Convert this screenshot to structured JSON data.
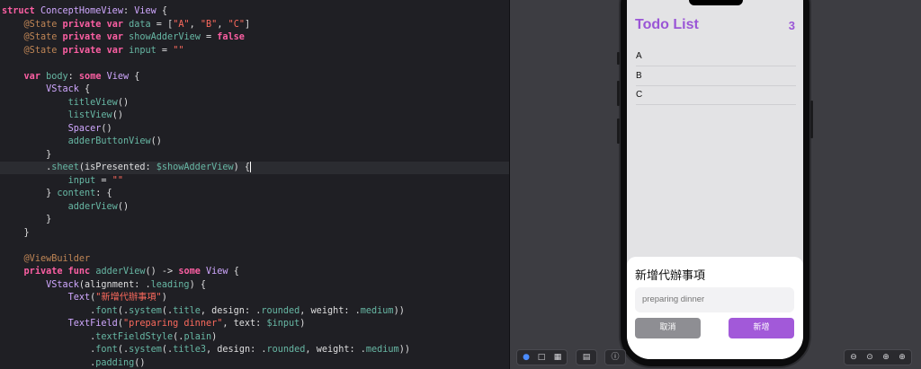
{
  "code": {
    "lines": [
      [
        {
          "t": "struct",
          "c": "kw"
        },
        {
          "t": " ",
          "c": "pl"
        },
        {
          "t": "ConceptHomeView",
          "c": "ty"
        },
        {
          "t": ": ",
          "c": "pl"
        },
        {
          "t": "View",
          "c": "ty"
        },
        {
          "t": " {",
          "c": "pl"
        }
      ],
      [
        {
          "t": "    ",
          "c": "pl"
        },
        {
          "t": "@State",
          "c": "attr"
        },
        {
          "t": " ",
          "c": "pl"
        },
        {
          "t": "private",
          "c": "kw"
        },
        {
          "t": " ",
          "c": "pl"
        },
        {
          "t": "var",
          "c": "kw"
        },
        {
          "t": " ",
          "c": "pl"
        },
        {
          "t": "data",
          "c": "prop"
        },
        {
          "t": " = [",
          "c": "pl"
        },
        {
          "t": "\"A\"",
          "c": "str"
        },
        {
          "t": ", ",
          "c": "pl"
        },
        {
          "t": "\"B\"",
          "c": "str"
        },
        {
          "t": ", ",
          "c": "pl"
        },
        {
          "t": "\"C\"",
          "c": "str"
        },
        {
          "t": "]",
          "c": "pl"
        }
      ],
      [
        {
          "t": "    ",
          "c": "pl"
        },
        {
          "t": "@State",
          "c": "attr"
        },
        {
          "t": " ",
          "c": "pl"
        },
        {
          "t": "private",
          "c": "kw"
        },
        {
          "t": " ",
          "c": "pl"
        },
        {
          "t": "var",
          "c": "kw"
        },
        {
          "t": " ",
          "c": "pl"
        },
        {
          "t": "showAdderView",
          "c": "prop"
        },
        {
          "t": " = ",
          "c": "pl"
        },
        {
          "t": "false",
          "c": "kw"
        }
      ],
      [
        {
          "t": "    ",
          "c": "pl"
        },
        {
          "t": "@State",
          "c": "attr"
        },
        {
          "t": " ",
          "c": "pl"
        },
        {
          "t": "private",
          "c": "kw"
        },
        {
          "t": " ",
          "c": "pl"
        },
        {
          "t": "var",
          "c": "kw"
        },
        {
          "t": " ",
          "c": "pl"
        },
        {
          "t": "input",
          "c": "prop"
        },
        {
          "t": " = ",
          "c": "pl"
        },
        {
          "t": "\"\"",
          "c": "str"
        }
      ],
      [],
      [
        {
          "t": "    ",
          "c": "pl"
        },
        {
          "t": "var",
          "c": "kw"
        },
        {
          "t": " ",
          "c": "pl"
        },
        {
          "t": "body",
          "c": "prop"
        },
        {
          "t": ": ",
          "c": "pl"
        },
        {
          "t": "some",
          "c": "kw"
        },
        {
          "t": " ",
          "c": "pl"
        },
        {
          "t": "View",
          "c": "ty"
        },
        {
          "t": " {",
          "c": "pl"
        }
      ],
      [
        {
          "t": "        ",
          "c": "pl"
        },
        {
          "t": "VStack",
          "c": "ty"
        },
        {
          "t": " {",
          "c": "pl"
        }
      ],
      [
        {
          "t": "            ",
          "c": "pl"
        },
        {
          "t": "titleView",
          "c": "fn"
        },
        {
          "t": "()",
          "c": "pl"
        }
      ],
      [
        {
          "t": "            ",
          "c": "pl"
        },
        {
          "t": "listView",
          "c": "fn"
        },
        {
          "t": "()",
          "c": "pl"
        }
      ],
      [
        {
          "t": "            ",
          "c": "pl"
        },
        {
          "t": "Spacer",
          "c": "ty"
        },
        {
          "t": "()",
          "c": "pl"
        }
      ],
      [
        {
          "t": "            ",
          "c": "pl"
        },
        {
          "t": "adderButtonView",
          "c": "fn"
        },
        {
          "t": "()",
          "c": "pl"
        }
      ],
      [
        {
          "t": "        }",
          "c": "pl"
        }
      ],
      [
        {
          "t": "        .",
          "c": "pl"
        },
        {
          "t": "sheet",
          "c": "fn"
        },
        {
          "t": "(isPresented: ",
          "c": "pl"
        },
        {
          "t": "$showAdderView",
          "c": "prop"
        },
        {
          "t": ") {",
          "c": "pl"
        }
      ],
      [
        {
          "t": "            ",
          "c": "pl"
        },
        {
          "t": "input",
          "c": "prop"
        },
        {
          "t": " = ",
          "c": "pl"
        },
        {
          "t": "\"\"",
          "c": "str"
        }
      ],
      [
        {
          "t": "        } ",
          "c": "pl"
        },
        {
          "t": "content",
          "c": "fn"
        },
        {
          "t": ": {",
          "c": "pl"
        }
      ],
      [
        {
          "t": "            ",
          "c": "pl"
        },
        {
          "t": "adderView",
          "c": "fn"
        },
        {
          "t": "()",
          "c": "pl"
        }
      ],
      [
        {
          "t": "        }",
          "c": "pl"
        }
      ],
      [
        {
          "t": "    }",
          "c": "pl"
        }
      ],
      [],
      [
        {
          "t": "    ",
          "c": "pl"
        },
        {
          "t": "@ViewBuilder",
          "c": "attr"
        }
      ],
      [
        {
          "t": "    ",
          "c": "pl"
        },
        {
          "t": "private",
          "c": "kw"
        },
        {
          "t": " ",
          "c": "pl"
        },
        {
          "t": "func",
          "c": "kw"
        },
        {
          "t": " ",
          "c": "pl"
        },
        {
          "t": "adderView",
          "c": "fn"
        },
        {
          "t": "() -> ",
          "c": "pl"
        },
        {
          "t": "some",
          "c": "kw"
        },
        {
          "t": " ",
          "c": "pl"
        },
        {
          "t": "View",
          "c": "ty"
        },
        {
          "t": " {",
          "c": "pl"
        }
      ],
      [
        {
          "t": "        ",
          "c": "pl"
        },
        {
          "t": "VStack",
          "c": "ty"
        },
        {
          "t": "(alignment: .",
          "c": "pl"
        },
        {
          "t": "leading",
          "c": "prop"
        },
        {
          "t": ") {",
          "c": "pl"
        }
      ],
      [
        {
          "t": "            ",
          "c": "pl"
        },
        {
          "t": "Text",
          "c": "ty"
        },
        {
          "t": "(",
          "c": "pl"
        },
        {
          "t": "\"新增代辦事項\"",
          "c": "str"
        },
        {
          "t": ")",
          "c": "pl"
        }
      ],
      [
        {
          "t": "                .",
          "c": "pl"
        },
        {
          "t": "font",
          "c": "fn"
        },
        {
          "t": "(.",
          "c": "pl"
        },
        {
          "t": "system",
          "c": "fn"
        },
        {
          "t": "(.",
          "c": "pl"
        },
        {
          "t": "title",
          "c": "prop"
        },
        {
          "t": ", design: .",
          "c": "pl"
        },
        {
          "t": "rounded",
          "c": "prop"
        },
        {
          "t": ", weight: .",
          "c": "pl"
        },
        {
          "t": "medium",
          "c": "prop"
        },
        {
          "t": "))",
          "c": "pl"
        }
      ],
      [
        {
          "t": "            ",
          "c": "pl"
        },
        {
          "t": "TextField",
          "c": "ty"
        },
        {
          "t": "(",
          "c": "pl"
        },
        {
          "t": "\"preparing dinner\"",
          "c": "str"
        },
        {
          "t": ", text: ",
          "c": "pl"
        },
        {
          "t": "$input",
          "c": "prop"
        },
        {
          "t": ")",
          "c": "pl"
        }
      ],
      [
        {
          "t": "                .",
          "c": "pl"
        },
        {
          "t": "textFieldStyle",
          "c": "fn"
        },
        {
          "t": "(.",
          "c": "pl"
        },
        {
          "t": "plain",
          "c": "prop"
        },
        {
          "t": ")",
          "c": "pl"
        }
      ],
      [
        {
          "t": "                .",
          "c": "pl"
        },
        {
          "t": "font",
          "c": "fn"
        },
        {
          "t": "(.",
          "c": "pl"
        },
        {
          "t": "system",
          "c": "fn"
        },
        {
          "t": "(.",
          "c": "pl"
        },
        {
          "t": "title3",
          "c": "prop"
        },
        {
          "t": ", design: .",
          "c": "pl"
        },
        {
          "t": "rounded",
          "c": "prop"
        },
        {
          "t": ", weight: .",
          "c": "pl"
        },
        {
          "t": "medium",
          "c": "prop"
        },
        {
          "t": "))",
          "c": "pl"
        }
      ],
      [
        {
          "t": "                .",
          "c": "pl"
        },
        {
          "t": "padding",
          "c": "fn"
        },
        {
          "t": "()",
          "c": "pl"
        }
      ]
    ]
  },
  "preview": {
    "title": "Todo List",
    "count": "3",
    "items": [
      {
        "label": "A"
      },
      {
        "label": "B"
      },
      {
        "label": "C"
      }
    ],
    "sheet": {
      "title": "新增代辦事項",
      "placeholder": "preparing dinner",
      "cancel_label": "取消",
      "add_label": "新增"
    },
    "accent_color": "#9a55d6"
  },
  "toolbar": {
    "left_icons": [
      "play-icon",
      "select-icon",
      "grid-icon",
      "device-settings-icon",
      "info-icon"
    ],
    "right_icons": [
      "zoom-out-icon",
      "zoom-fit-icon",
      "zoom-actual-icon",
      "zoom-in-icon"
    ]
  }
}
